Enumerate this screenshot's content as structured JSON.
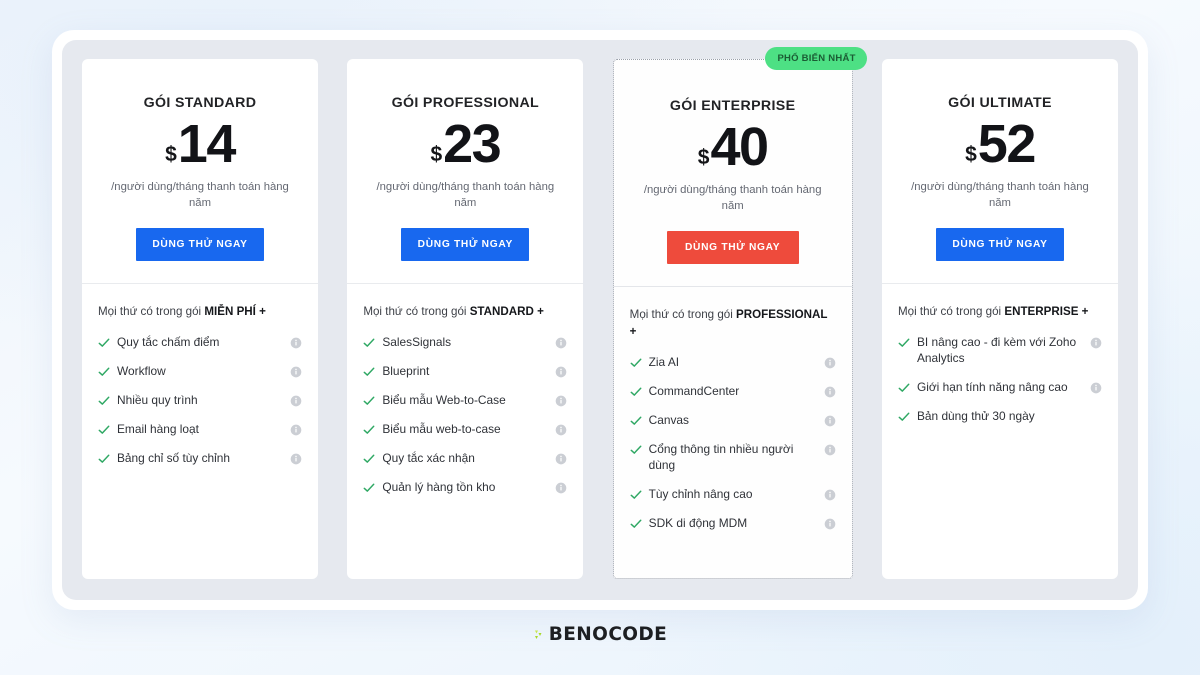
{
  "theme": {
    "accent_blue": "#1868ef",
    "accent_red": "#ee4b3c",
    "badge_green": "#4de084",
    "check_green": "#2fa864",
    "panel_gray": "#e6e9ef"
  },
  "brand": {
    "name": "BENOCODE"
  },
  "plans": [
    {
      "title": "GÓI STANDARD",
      "currency": "$",
      "price": "14",
      "price_note": "/người dùng/tháng thanh toán hàng năm",
      "cta_label": "DÙNG THỬ NGAY",
      "cta_style": "blue",
      "includes_prefix": "Mọi thứ có trong gói ",
      "includes_plan": "MIỄN PHÍ +",
      "featured": false,
      "badge": "",
      "features": [
        {
          "label": "Quy tắc chấm điểm",
          "info": true
        },
        {
          "label": "Workflow",
          "info": true
        },
        {
          "label": "Nhiều quy trình",
          "info": true
        },
        {
          "label": "Email hàng loạt",
          "info": true
        },
        {
          "label": "Bảng chỉ số tùy chỉnh",
          "info": true
        }
      ]
    },
    {
      "title": "GÓI PROFESSIONAL",
      "currency": "$",
      "price": "23",
      "price_note": "/người dùng/tháng thanh toán hàng năm",
      "cta_label": "DÙNG THỬ NGAY",
      "cta_style": "blue",
      "includes_prefix": "Mọi thứ có trong gói ",
      "includes_plan": "STANDARD +",
      "featured": false,
      "badge": "",
      "features": [
        {
          "label": "SalesSignals",
          "info": true
        },
        {
          "label": "Blueprint",
          "info": true
        },
        {
          "label": "Biểu mẫu Web-to-Case",
          "info": true
        },
        {
          "label": "Biểu mẫu web-to-case",
          "info": true
        },
        {
          "label": "Quy tắc xác nhận",
          "info": true
        },
        {
          "label": "Quản lý hàng tồn kho",
          "info": true
        }
      ]
    },
    {
      "title": "GÓI ENTERPRISE",
      "currency": "$",
      "price": "40",
      "price_note": "/người dùng/tháng thanh toán hàng năm",
      "cta_label": "DÙNG THỬ NGAY",
      "cta_style": "red",
      "includes_prefix": "Mọi thứ có trong gói ",
      "includes_plan": "PROFESSIONAL +",
      "featured": true,
      "badge": "PHỔ BIẾN NHẤT",
      "features": [
        {
          "label": "Zia AI",
          "info": true
        },
        {
          "label": "CommandCenter",
          "info": true
        },
        {
          "label": "Canvas",
          "info": true
        },
        {
          "label": "Cổng thông tin nhiều người dùng",
          "info": true
        },
        {
          "label": "Tùy chỉnh nâng cao",
          "info": true
        },
        {
          "label": "SDK di động MDM",
          "info": true
        }
      ]
    },
    {
      "title": "GÓI ULTIMATE",
      "currency": "$",
      "price": "52",
      "price_note": "/người dùng/tháng thanh toán hàng năm",
      "cta_label": "DÙNG THỬ NGAY",
      "cta_style": "blue",
      "includes_prefix": "Mọi thứ có trong gói ",
      "includes_plan": "ENTERPRISE +",
      "featured": false,
      "badge": "",
      "features": [
        {
          "label": "BI nâng cao - đi kèm với Zoho Analytics",
          "info": true
        },
        {
          "label": "Giới hạn tính năng nâng cao",
          "info": true
        },
        {
          "label": "Bản dùng thử 30 ngày",
          "info": false
        }
      ]
    }
  ]
}
